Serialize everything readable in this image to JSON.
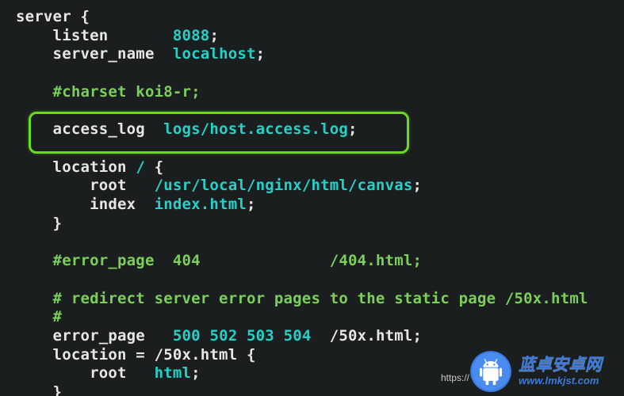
{
  "code": {
    "l1": "server {",
    "l2a": "    listen       ",
    "l2b": "8088",
    "l2c": ";",
    "l3a": "    server_name  ",
    "l3b": "localhost",
    "l3c": ";",
    "l5": "    #charset koi8-r;",
    "l7a": "    access_log  ",
    "l7b": "logs/host.access.log",
    "l7c": ";",
    "l9a": "    location ",
    "l9b": "/",
    "l9c": " {",
    "l10a": "        root   ",
    "l10b": "/usr/local/nginx/html/canvas",
    "l10c": ";",
    "l11a": "        index  ",
    "l11b": "index.html",
    "l11c": ";",
    "l12": "    }",
    "l14": "    #error_page  404              /404.html;",
    "l16": "    # redirect server error pages to the static page /50x.html",
    "l17": "    #",
    "l18a": "    error_page   ",
    "l18b": "500",
    "l18c": " ",
    "l18d": "502",
    "l18e": " ",
    "l18f": "503",
    "l18g": " ",
    "l18h": "504",
    "l18i": "  /50x.html;",
    "l19": "    location = /50x.html {",
    "l20a": "        root   ",
    "l20b": "html",
    "l20c": ";",
    "l21": "    }"
  },
  "url_fragment": "https://",
  "watermark": {
    "title": "蓝卓安卓网",
    "domain": "www.lmkjst.com"
  }
}
